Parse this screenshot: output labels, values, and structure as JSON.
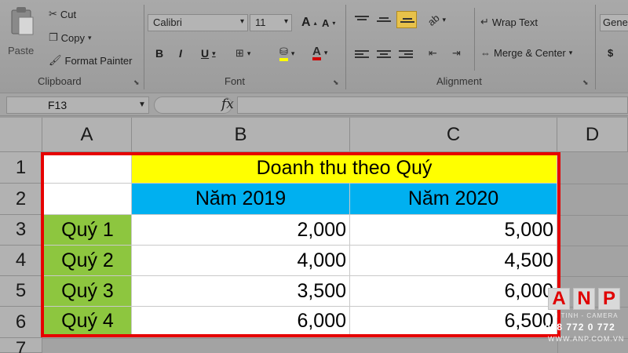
{
  "ribbon": {
    "clipboard": {
      "paste_label": "Paste",
      "cut_label": "Cut",
      "copy_label": "Copy",
      "format_painter_label": "Format Painter",
      "group_label": "Clipboard"
    },
    "font": {
      "font_name": "Calibri",
      "font_size": "11",
      "group_label": "Font",
      "bold": "B",
      "italic": "I",
      "underline": "U",
      "grow": "A",
      "shrink": "A"
    },
    "alignment": {
      "wrap_text_label": "Wrap Text",
      "merge_center_label": "Merge & Center",
      "group_label": "Alignment"
    },
    "number": {
      "format": "Gene",
      "currency": "$"
    }
  },
  "formula_bar": {
    "name_box": "F13",
    "fx": "fx"
  },
  "grid": {
    "columns": [
      "A",
      "B",
      "C",
      "D"
    ],
    "rows": [
      "1",
      "2",
      "3",
      "4",
      "5",
      "6",
      "7"
    ],
    "title": "Doanh thu theo Quý",
    "years": [
      "Năm 2019",
      "Năm 2020"
    ],
    "data_rows": [
      {
        "quarter": "Quý 1",
        "y2019": "2,000",
        "y2020": "5,000"
      },
      {
        "quarter": "Quý 2",
        "y2019": "4,000",
        "y2020": "4,500"
      },
      {
        "quarter": "Quý 3",
        "y2019": "3,500",
        "y2020": "6,000"
      },
      {
        "quarter": "Quý 4",
        "y2019": "6,000",
        "y2020": "6,500"
      }
    ]
  },
  "watermark": {
    "letters": [
      "A",
      "N",
      "P"
    ],
    "tag": "VI TINH - CAMERA",
    "phone": "038 772 0 772",
    "site": "WWW.ANP.COM.VN"
  },
  "colors": {
    "title_fill": "#ffff00",
    "year_fill": "#00b0f0",
    "quarter_fill": "#8dc63f",
    "highlight_border": "#e60000"
  }
}
